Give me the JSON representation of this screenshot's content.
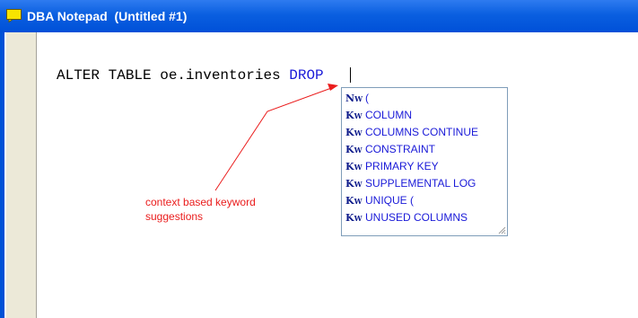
{
  "window": {
    "title": "DBA Notepad  (Untitled #1)"
  },
  "editor": {
    "code_plain": "ALTER TABLE oe.inventories ",
    "code_keyword": "DROP",
    "code_trail": " "
  },
  "suggestions": [
    {
      "icon": "N",
      "label": "("
    },
    {
      "icon": "K",
      "label": "COLUMN"
    },
    {
      "icon": "K",
      "label": "COLUMNS CONTINUE"
    },
    {
      "icon": "K",
      "label": "CONSTRAINT"
    },
    {
      "icon": "K",
      "label": "PRIMARY KEY"
    },
    {
      "icon": "K",
      "label": "SUPPLEMENTAL LOG"
    },
    {
      "icon": "K",
      "label": "UNIQUE ("
    },
    {
      "icon": "K",
      "label": "UNUSED COLUMNS"
    }
  ],
  "annotation": {
    "text": "context based keyword suggestions",
    "color": "#ea1c1c"
  },
  "colors": {
    "titlebar": "#0a5fe0",
    "keyword": "#1a1ad8",
    "gutter": "#ece9d8"
  }
}
